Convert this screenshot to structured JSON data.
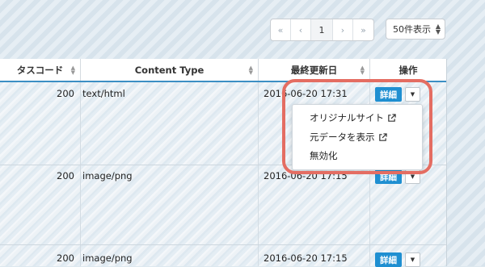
{
  "pagination": {
    "first": "«",
    "prev": "‹",
    "current": "1",
    "next": "›",
    "last": "»"
  },
  "per_page": {
    "selected": "50件表示"
  },
  "table": {
    "headers": [
      "タスコード",
      "Content Type",
      "最終更新日",
      "操作"
    ],
    "rows": [
      {
        "status": "200",
        "content_type": "text/html",
        "updated": "2016-06-20 17:31",
        "detail": "詳細"
      },
      {
        "status": "200",
        "content_type": "image/png",
        "updated": "2016-06-20 17:15",
        "detail": "詳細"
      },
      {
        "status": "200",
        "content_type": "image/png",
        "updated": "2016-06-20 17:15",
        "detail": "詳細"
      }
    ]
  },
  "dropdown": {
    "items": [
      {
        "label": "オリジナルサイト",
        "icon": "external-link-icon"
      },
      {
        "label": "元データを表示",
        "icon": "external-link-icon"
      },
      {
        "label": "無効化"
      }
    ]
  },
  "colors": {
    "accent": "#1f8fd1",
    "highlight": "#e46d62",
    "header_rule": "#3c8fc4"
  }
}
